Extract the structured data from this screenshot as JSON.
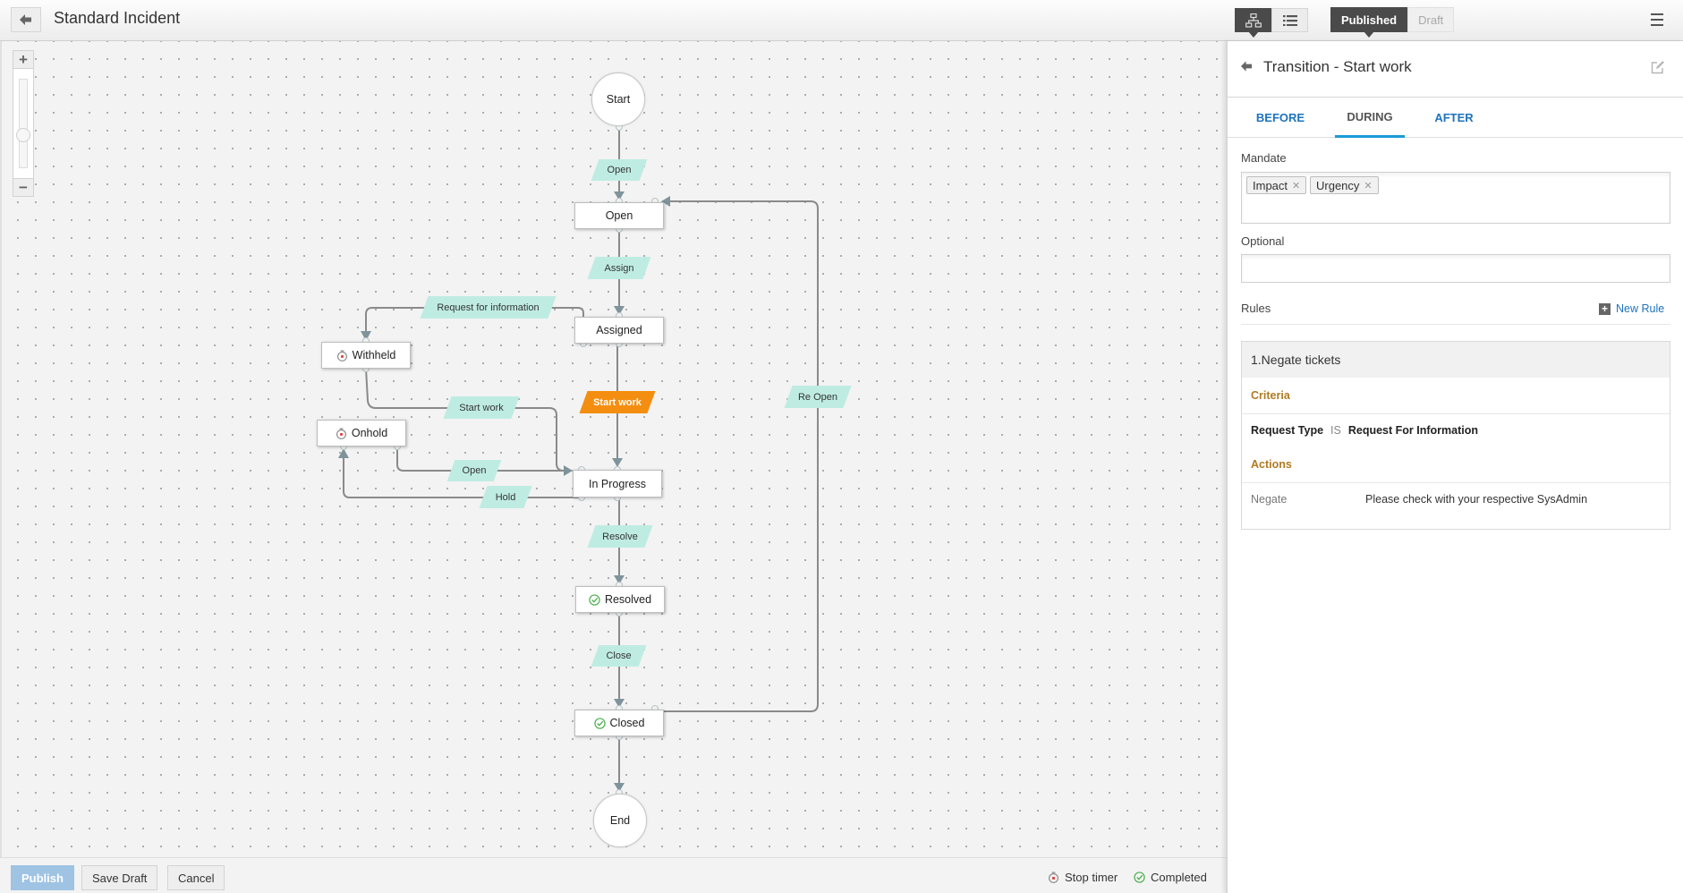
{
  "header": {
    "back_icon": "arrow-left-icon",
    "title": "Standard Incident",
    "view_toggle": [
      {
        "icon": "sitemap-icon",
        "label": "Diagram view",
        "active": true
      },
      {
        "icon": "list-icon",
        "label": "List view",
        "active": false
      }
    ],
    "status_toggle": [
      {
        "label": "Published",
        "active": true
      },
      {
        "label": "Draft",
        "active": false
      }
    ],
    "menu_icon": "hamburger-menu-icon"
  },
  "canvas": {
    "zoom": {
      "plus_label": "+",
      "minus_label": "−",
      "level": 0.5
    },
    "states": [
      {
        "id": "start",
        "label": "Start",
        "type": "start"
      },
      {
        "id": "open",
        "label": "Open",
        "type": "state"
      },
      {
        "id": "assigned",
        "label": "Assigned",
        "type": "state"
      },
      {
        "id": "withheld",
        "label": "Withheld",
        "type": "state",
        "icon": "stop-timer"
      },
      {
        "id": "onhold",
        "label": "Onhold",
        "type": "state",
        "icon": "stop-timer"
      },
      {
        "id": "inprogress",
        "label": "In Progress",
        "type": "state"
      },
      {
        "id": "resolved",
        "label": "Resolved",
        "type": "state",
        "icon": "completed"
      },
      {
        "id": "closed",
        "label": "Closed",
        "type": "state",
        "icon": "completed"
      },
      {
        "id": "end",
        "label": "End",
        "type": "end"
      }
    ],
    "transitions": [
      {
        "label": "Open",
        "from": "start",
        "to": "open",
        "active": false
      },
      {
        "label": "Assign",
        "from": "open",
        "to": "assigned",
        "active": false
      },
      {
        "label": "Request for information",
        "from": "assigned",
        "to": "withheld",
        "active": false
      },
      {
        "label": "Start work",
        "from": "withheld",
        "to": "inprogress",
        "active": false
      },
      {
        "label": "Start work",
        "from": "assigned",
        "to": "inprogress",
        "active": true
      },
      {
        "label": "Re Open",
        "from": "closed",
        "to": "open",
        "active": false
      },
      {
        "label": "Open",
        "from": "onhold",
        "to": "inprogress",
        "active": false
      },
      {
        "label": "Hold",
        "from": "inprogress",
        "to": "onhold",
        "active": false
      },
      {
        "label": "Resolve",
        "from": "inprogress",
        "to": "resolved",
        "active": false
      },
      {
        "label": "Close",
        "from": "resolved",
        "to": "closed",
        "active": false
      },
      {
        "label": "",
        "from": "closed",
        "to": "end",
        "active": false
      }
    ],
    "colors": {
      "transition": "#bfece2",
      "transition_active": "#f48e10",
      "timer": "#e53935",
      "completed": "#4caf50"
    }
  },
  "footer": {
    "publish_label": "Publish",
    "save_draft_label": "Save Draft",
    "cancel_label": "Cancel",
    "legend": [
      {
        "icon": "stop-timer-icon",
        "label": "Stop timer"
      },
      {
        "icon": "completed-check-icon",
        "label": "Completed"
      }
    ]
  },
  "panel": {
    "title": "Transition - Start work",
    "tabs": [
      {
        "label": "BEFORE",
        "active": false
      },
      {
        "label": "DURING",
        "active": true
      },
      {
        "label": "AFTER",
        "active": false
      }
    ],
    "mandate_label": "Mandate",
    "mandate_tags": [
      "Impact",
      "Urgency"
    ],
    "optional_label": "Optional",
    "optional_tags": [],
    "rules_label": "Rules",
    "new_rule_label": "New Rule",
    "rules": [
      {
        "title": "1.Negate tickets",
        "criteria_label": "Criteria",
        "criteria": {
          "field": "Request Type",
          "operator": "IS",
          "value": "Request For Information"
        },
        "actions_label": "Actions",
        "actions": [
          {
            "type": "Negate",
            "message": "Please check with your respective SysAdmin"
          }
        ]
      }
    ]
  }
}
